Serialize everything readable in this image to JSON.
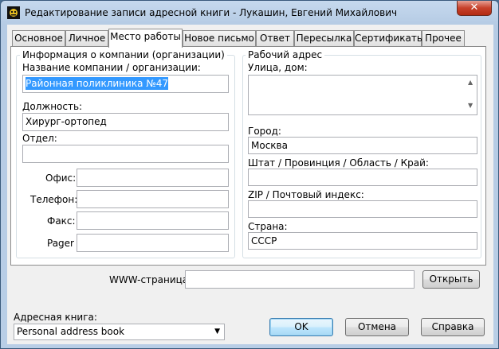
{
  "window": {
    "title": "Редактирование записи адресной книги - Лукашин, Евгений Михайлович",
    "close_glyph": "✕"
  },
  "tabs": [
    {
      "label": "Основное"
    },
    {
      "label": "Личное"
    },
    {
      "label": "Место работы"
    },
    {
      "label": "Новое письмо"
    },
    {
      "label": "Ответ"
    },
    {
      "label": "Пересылка"
    },
    {
      "label": "Сертификаты"
    },
    {
      "label": "Прочее"
    }
  ],
  "company": {
    "group_title": "Информация о компании (организации)",
    "name_label": "Название компании / организации:",
    "name_value": "Районная поликлиника №47",
    "position_label": "Должность:",
    "position_value": "Хирург-ортопед",
    "department_label": "Отдел:",
    "department_value": "",
    "office_label": "Офис:",
    "office_value": "",
    "phone_label": "Телефон:",
    "phone_value": "",
    "fax_label": "Факс:",
    "fax_value": "",
    "pager_label": "Pager",
    "pager_value": ""
  },
  "address": {
    "group_title": "Рабочий адрес",
    "street_label": "Улица, дом:",
    "street_value": "",
    "city_label": "Город:",
    "city_value": "Москва",
    "state_label": "Штат / Провинция / Область / Край:",
    "state_value": "",
    "zip_label": "ZIP / Почтовый индекс:",
    "zip_value": "",
    "country_label": "Страна:",
    "country_value": "СССР"
  },
  "www": {
    "label": "WWW-страница:",
    "value": "",
    "open_button": "Открыть"
  },
  "footer": {
    "addressbook_label": "Адресная книга:",
    "addressbook_value": "Personal address book",
    "ok": "OK",
    "cancel": "Отмена",
    "help": "Справка"
  }
}
